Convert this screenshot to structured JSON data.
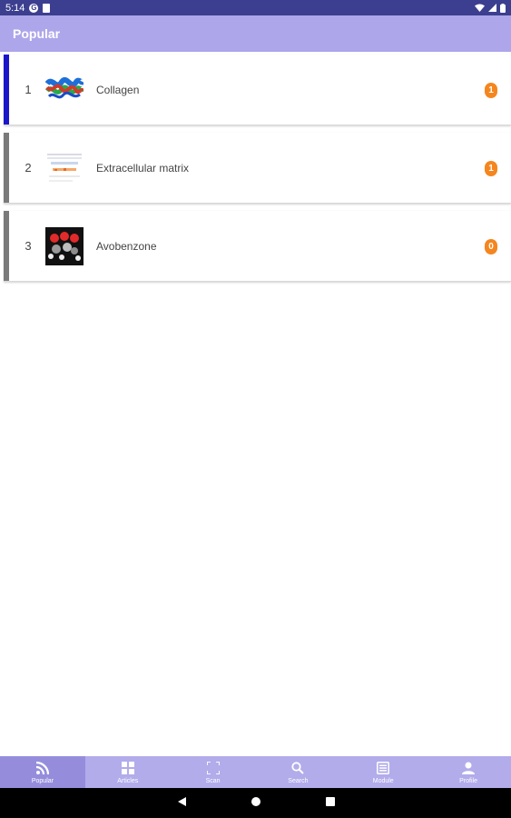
{
  "status_bar": {
    "time": "5:14"
  },
  "app_bar": {
    "title": "Popular"
  },
  "items": [
    {
      "rank": "1",
      "label": "Collagen",
      "count": "1",
      "accent": "#1b17c9",
      "thumb_icon": "collagen-structure-icon"
    },
    {
      "rank": "2",
      "label": "Extracellular matrix",
      "count": "1",
      "accent": "#7a7a7a",
      "thumb_icon": "matrix-diagram-icon"
    },
    {
      "rank": "3",
      "label": "Avobenzone",
      "count": "0",
      "accent": "#7a7a7a",
      "thumb_icon": "avobenzone-molecule-icon"
    }
  ],
  "bottom_nav": [
    {
      "label": "Popular",
      "icon": "rss-icon",
      "active": true
    },
    {
      "label": "Articles",
      "icon": "grid-icon",
      "active": false
    },
    {
      "label": "Scan",
      "icon": "scan-icon",
      "active": false
    },
    {
      "label": "Search",
      "icon": "search-icon",
      "active": false
    },
    {
      "label": "Module",
      "icon": "module-icon",
      "active": false
    },
    {
      "label": "Profile",
      "icon": "person-icon",
      "active": false
    }
  ],
  "colors": {
    "status_bar": "#3c3f8f",
    "app_bar": "#ada6ea",
    "bottom_nav": "#b2aceb",
    "badge": "#f5861f"
  }
}
